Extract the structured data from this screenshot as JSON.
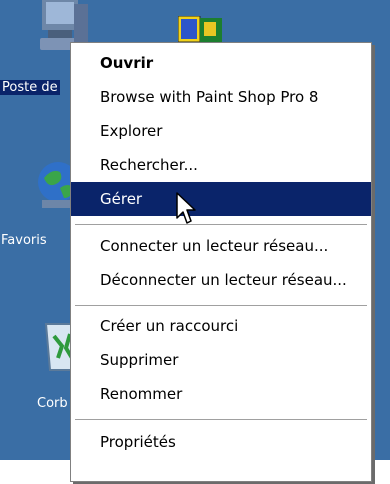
{
  "desktop": {
    "background": "#3a6ea5",
    "icons": [
      {
        "label": "Poste de",
        "icon": "my-computer-icon",
        "selected": true
      },
      {
        "label": "Favoris",
        "icon": "network-favorites-icon"
      },
      {
        "label": "Corb",
        "icon": "recycle-bin-icon"
      },
      {
        "label": "",
        "icon": "paint-shop-pro-icon"
      }
    ]
  },
  "context_menu": {
    "items": [
      {
        "label": "Ouvrir",
        "default": true
      },
      {
        "label": "Browse with Paint Shop Pro 8"
      },
      {
        "label": "Explorer"
      },
      {
        "label": "Rechercher..."
      },
      {
        "label": "Gérer",
        "highlighted": true
      },
      {
        "label": "Connecter un lecteur réseau..."
      },
      {
        "label": "Déconnecter un lecteur réseau..."
      },
      {
        "label": "Créer un raccourci"
      },
      {
        "label": "Supprimer"
      },
      {
        "label": "Renommer"
      },
      {
        "label": "Propriétés"
      }
    ],
    "highlight_color": "#0a246a"
  }
}
